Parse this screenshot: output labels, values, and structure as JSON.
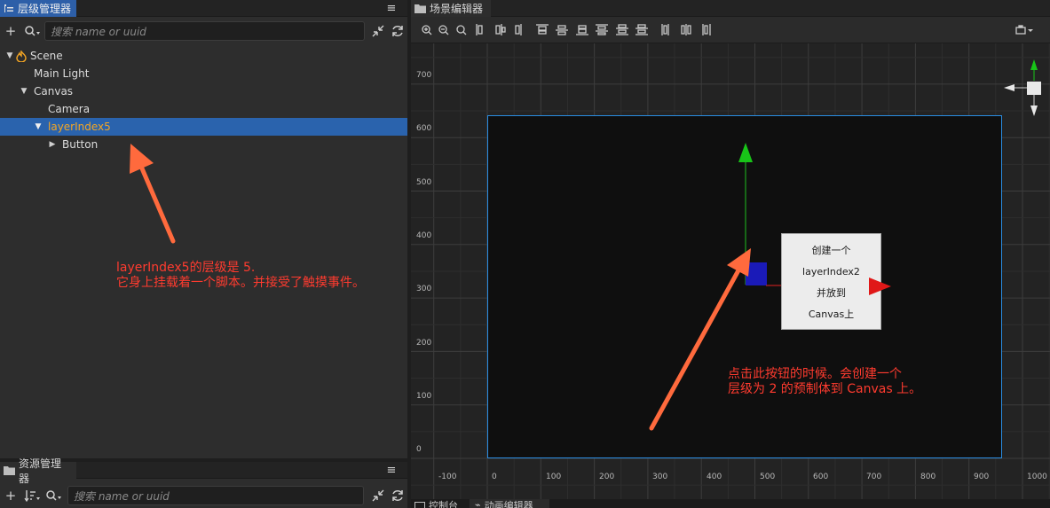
{
  "hierarchy": {
    "tab_title": "层级管理器",
    "search_placeholder": "搜索 name or uuid",
    "tree": [
      {
        "label": "Scene",
        "depth": 0,
        "expanded": true,
        "icon": "scene-icon"
      },
      {
        "label": "Main Light",
        "depth": 1
      },
      {
        "label": "Canvas",
        "depth": 1,
        "expanded": true
      },
      {
        "label": "Camera",
        "depth": 2
      },
      {
        "label": "layerIndex5",
        "depth": 2,
        "expanded": true,
        "selected": true
      },
      {
        "label": "Button",
        "depth": 3,
        "expanded": false
      }
    ]
  },
  "assets": {
    "tab_title": "资源管理器",
    "search_placeholder": "搜索 name or uuid"
  },
  "scene_editor": {
    "tab_title": "场景编辑器",
    "y_ticks": [
      "700",
      "600",
      "500",
      "400",
      "300",
      "200",
      "100",
      "0"
    ],
    "x_ticks": [
      "-100",
      "0",
      "100",
      "200",
      "300",
      "400",
      "500",
      "600",
      "700",
      "800",
      "900",
      "1000"
    ],
    "button_node_lines": [
      "创建一个",
      "layerIndex2",
      "并放到",
      "Canvas上"
    ]
  },
  "bottom_tabs": [
    "控制台",
    "动画编辑器"
  ],
  "annotations": {
    "left_line1": "layerIndex5的层级是 5.",
    "left_line2": "它身上挂载着一个脚本。并接受了触摸事件。",
    "right_line1": "点击此按钮的时候。会创建一个",
    "right_line2": "层级为 2 的预制体到 Canvas 上。"
  },
  "colors": {
    "selection_blue": "#2a63ad",
    "selected_text": "#f5a623",
    "annotation_red": "#ff3b2f",
    "arrow_orange": "#ff6a3d",
    "canvas_border": "#2a8ce0"
  }
}
